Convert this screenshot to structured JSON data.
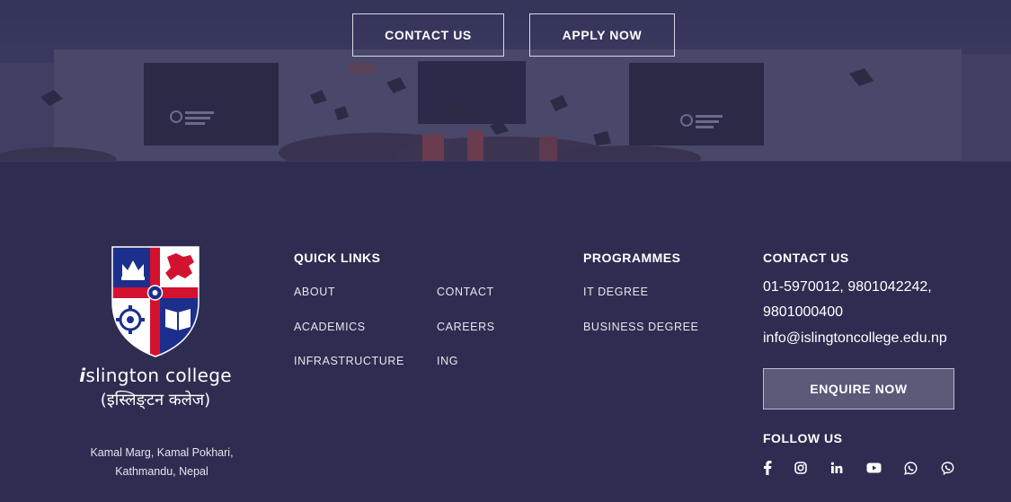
{
  "hero": {
    "contact_label": "CONTACT US",
    "apply_label": "APPLY NOW"
  },
  "brand": {
    "name_mark": "i",
    "name_rest": "slington college",
    "name_nepali": "(इस्लिङ्टन कलेज)",
    "address_line1": "Kamal Marg, Kamal Pokhari,",
    "address_line2": "Kathmandu, Nepal"
  },
  "quick_links": {
    "heading": "QUICK LINKS",
    "items": [
      "ABOUT",
      "ACADEMICS",
      "INFRASTRUCTURE",
      "CONTACT",
      "CAREERS",
      "ING"
    ]
  },
  "programmes": {
    "heading": "PROGRAMMES",
    "items": [
      "IT DEGREE",
      "BUSINESS DEGREE"
    ]
  },
  "contact": {
    "heading": "CONTACT US",
    "phone_line1": "01-5970012, 9801042242,",
    "phone_line2": "9801000400",
    "email": "info@islingtoncollege.edu.np",
    "enquire_label": "ENQUIRE NOW"
  },
  "follow": {
    "heading": "FOLLOW US",
    "icons": [
      "facebook-icon",
      "instagram-icon",
      "linkedin-icon",
      "youtube-icon",
      "whatsapp-icon",
      "viber-icon"
    ]
  },
  "colors": {
    "background": "#2e2d51",
    "crest_blue": "#1c2f8c",
    "crest_red": "#d3122f",
    "button_fill": "#5a5978"
  }
}
